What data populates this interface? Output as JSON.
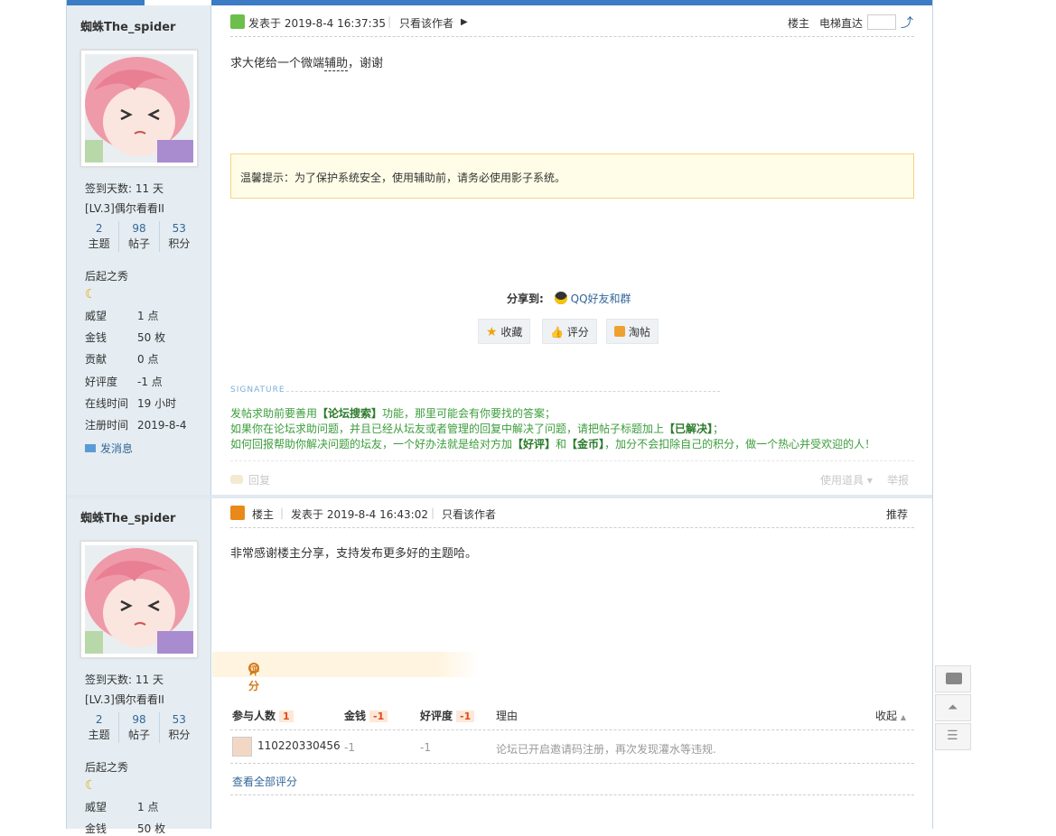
{
  "post1": {
    "author": "蜘蛛The_spider",
    "sign_days": "签到天数: 11 天",
    "level": "[LV.3]偶尔看看II",
    "stats": [
      {
        "num": "2",
        "label": "主题"
      },
      {
        "num": "98",
        "label": "帖子"
      },
      {
        "num": "53",
        "label": "积分"
      }
    ],
    "rank": "后起之秀",
    "props": [
      {
        "k": "威望",
        "v": "1 点"
      },
      {
        "k": "金钱",
        "v": "50 枚"
      },
      {
        "k": "贡献",
        "v": "0 点"
      },
      {
        "k": "好评度",
        "v": "-1 点"
      },
      {
        "k": "在线时间",
        "v": "19 小时"
      },
      {
        "k": "注册时间",
        "v": "2019-8-4"
      }
    ],
    "send_msg": "发消息",
    "posted_at": "发表于 2019-8-4 16:37:35",
    "only_author": "只看该作者",
    "floor": "楼主",
    "jump_label": "电梯直达",
    "content_pre": "求大佬给一个微端",
    "content_link": "辅助",
    "content_post": "，谢谢",
    "notice": "温馨提示：为了保护系统安全，使用辅助前，请务必使用影子系统。",
    "share_label": "分享到:",
    "share_target": "QQ好友和群",
    "btn_fav": "收藏",
    "btn_rate": "评分",
    "btn_tao": "淘帖",
    "sig_title": "SIGNATURE",
    "sig1_a": "发帖求助前要善用",
    "sig1_b": "【论坛搜索】",
    "sig1_c": "功能，那里可能会有你要找的答案；",
    "sig2_a": "如果你在论坛求助问题，并且已经从坛友或者管理的回复中解决了问题，请把帖子标题加上",
    "sig2_b": "【已解决】",
    "sig2_c": "；",
    "sig3_a": "如何回报帮助你解决问题的坛友，一个好办法就是给对方加",
    "sig3_b": "【好评】",
    "sig3_c": "和",
    "sig3_d": "【金币】",
    "sig3_e": "，加分不会扣除自己的积分，做一个热心并受欢迎的人！",
    "reply": "回复",
    "use_tool": "使用道具",
    "report": "举报"
  },
  "post2": {
    "author": "蜘蛛The_spider",
    "sign_days": "签到天数: 11 天",
    "level": "[LV.3]偶尔看看II",
    "stats": [
      {
        "num": "2",
        "label": "主题"
      },
      {
        "num": "98",
        "label": "帖子"
      },
      {
        "num": "53",
        "label": "积分"
      }
    ],
    "rank": "后起之秀",
    "props": [
      {
        "k": "威望",
        "v": "1 点"
      },
      {
        "k": "金钱",
        "v": "50 枚"
      }
    ],
    "floor": "楼主",
    "posted_at": "发表于 2019-8-4 16:43:02",
    "only_author": "只看该作者",
    "recommend": "推荐",
    "content": "非常感谢楼主分享，支持发布更多好的主题哈。",
    "rate_title": "评分",
    "rate_cols": {
      "people": "参与人数",
      "people_n": "1",
      "money": "金钱",
      "money_n": "-1",
      "good": "好评度",
      "good_n": "-1",
      "reason": "理由"
    },
    "collapse": "收起",
    "rate_row": {
      "user": "110220330456",
      "money": "-1",
      "good": "-1",
      "reason": "论坛已开启邀请码注册，再次发现灌水等违规."
    },
    "view_all": "查看全部评分"
  },
  "colors": {
    "accent": "#3b7cc4",
    "sidebar": "#e5edf2",
    "signature": "#3c9d3c",
    "notice_bg": "#fffde7"
  }
}
